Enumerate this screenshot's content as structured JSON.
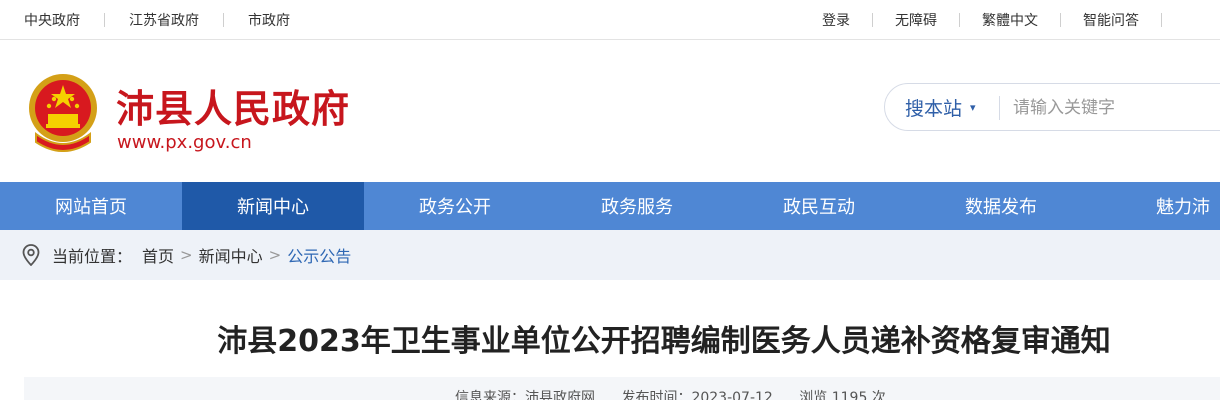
{
  "topbar": {
    "left_links": [
      "中央政府",
      "江苏省政府",
      "市政府"
    ],
    "right_links": [
      "登录",
      "无障碍",
      "繁體中文",
      "智能问答"
    ]
  },
  "header": {
    "title": "沛县人民政府",
    "url": "www.px.gov.cn",
    "emblem_icon": "national-emblem-icon"
  },
  "search": {
    "scope_label": "搜本站",
    "placeholder": "请输入关键字"
  },
  "nav": {
    "items": [
      "网站首页",
      "新闻中心",
      "政务公开",
      "政务服务",
      "政民互动",
      "数据发布",
      "魅力沛"
    ],
    "active": "新闻中心"
  },
  "breadcrumb": {
    "prefix": "当前位置：",
    "items": [
      "首页",
      "新闻中心",
      "公示公告"
    ]
  },
  "article": {
    "title": "沛县2023年卫生事业单位公开招聘编制医务人员递补资格复审通知",
    "source": "信息来源：沛县政府网",
    "date": "发布时间：2023-07-12",
    "views": "浏览 1195 次"
  },
  "colors": {
    "brand_red": "#c7161d",
    "nav_blue": "#4f87d4",
    "nav_active": "#1f59a8",
    "link_blue": "#2f68b4"
  }
}
